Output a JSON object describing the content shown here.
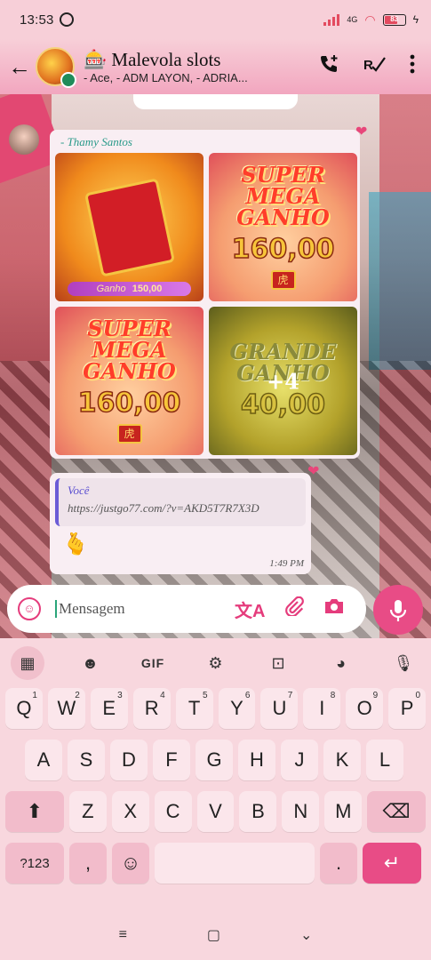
{
  "status": {
    "time": "13:53",
    "network": "4G",
    "battery": "83"
  },
  "header": {
    "group_name": "Malevola slots",
    "group_emoji": "🎰",
    "members": "- Ace, - ADM LAYON, - ADRIA..."
  },
  "chat": {
    "image_message": {
      "sender": "- Thamy Santos",
      "tiles": [
        {
          "bar_label": "Ganho",
          "bar_value": "150,00"
        },
        {
          "title_line1": "SUPER",
          "title_line2": "MEGA GANHO",
          "amount": "160,00",
          "seal": "虎"
        },
        {
          "title_line1": "SUPER",
          "title_line2": "MEGA GANHO",
          "amount": "160,00",
          "seal": "虎"
        },
        {
          "title_line1": "GRANDE",
          "title_line2": "GANHO",
          "amount": "40,00",
          "overlay": "+4"
        }
      ]
    },
    "reply_message": {
      "quoted_author": "Você",
      "quoted_text": "https://justgo77.com/?v=AKD5T7R7X3D",
      "emoji": "🫰",
      "time": "1:49 PM"
    }
  },
  "composer": {
    "placeholder": "Mensagem"
  },
  "keyboard": {
    "toolbar": {
      "gif": "GIF"
    },
    "row1": [
      "Q",
      "W",
      "E",
      "R",
      "T",
      "Y",
      "U",
      "I",
      "O",
      "P"
    ],
    "row1_hints": [
      "1",
      "2",
      "3",
      "4",
      "5",
      "6",
      "7",
      "8",
      "9",
      "0"
    ],
    "row2": [
      "A",
      "S",
      "D",
      "F",
      "G",
      "H",
      "J",
      "K",
      "L"
    ],
    "row3": [
      "Z",
      "X",
      "C",
      "V",
      "B",
      "N",
      "M"
    ],
    "symbols_key": "?123",
    "comma": ",",
    "period": "."
  },
  "icons": {
    "back": "arrow-left-icon",
    "add_call": "phone-plus-icon",
    "verified": "check-icon",
    "menu": "more-vert-icon",
    "translate": "translate-icon",
    "attach": "paperclip-icon",
    "camera": "camera-icon",
    "mic": "mic-icon"
  },
  "colors": {
    "accent": "#e84c86",
    "header": "#f2a6bf",
    "keyboard": "#f8d7de"
  }
}
